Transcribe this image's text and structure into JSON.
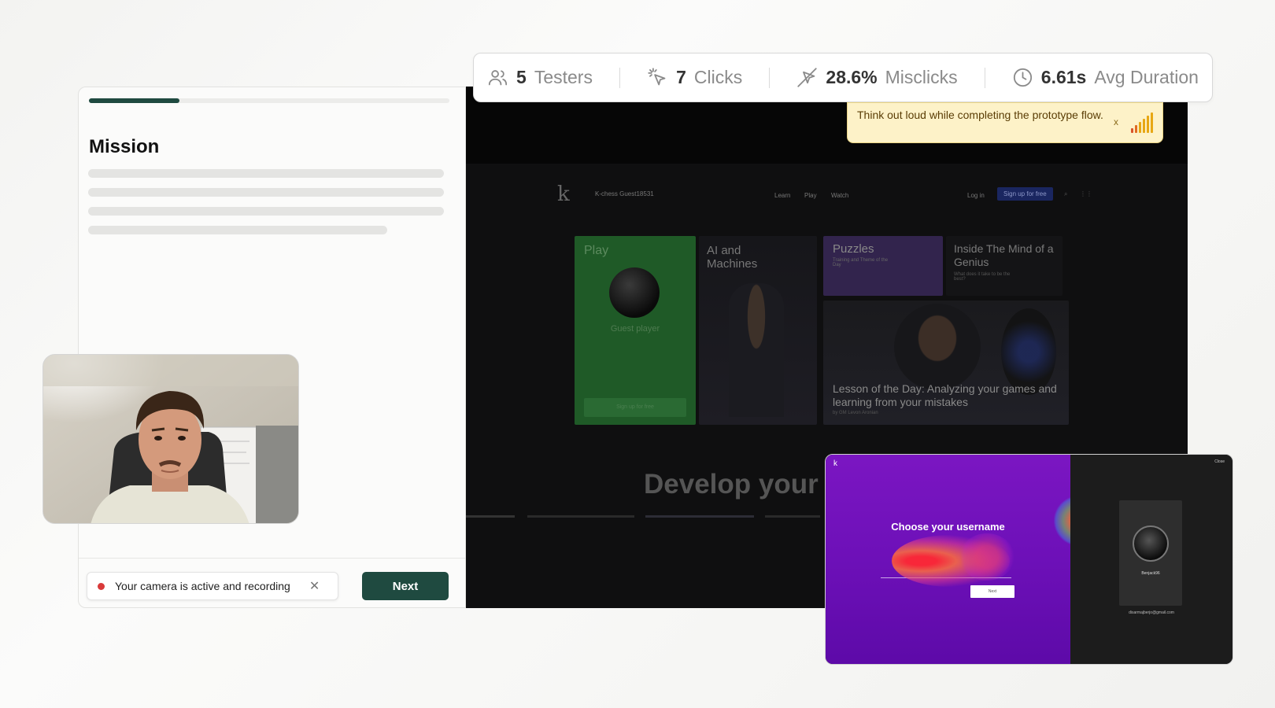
{
  "stats": {
    "testers": {
      "value": "5",
      "label": "Testers",
      "icon": "users-icon"
    },
    "clicks": {
      "value": "7",
      "label": "Clicks",
      "icon": "cursor-click-icon"
    },
    "misclicks": {
      "value": "28.6%",
      "label": "Misclicks",
      "icon": "cursor-off-icon"
    },
    "duration": {
      "value": "6.61s",
      "label": "Avg Duration",
      "icon": "clock-icon"
    }
  },
  "mission": {
    "title": "Mission",
    "progress": 0.25
  },
  "recording": {
    "status_text": "Your camera is active and recording",
    "close_glyph": "✕"
  },
  "next_label": "Next",
  "tooltip": {
    "text": "Think out loud while completing the prototype flow.",
    "close_glyph": "x"
  },
  "prototype": {
    "user": "K-chess Guest18531",
    "nav": [
      "Learn",
      "Play",
      "Watch"
    ],
    "login": "Log in",
    "signup": "Sign up for free",
    "tiles": {
      "play_title": "Play",
      "guest_player": "Guest player",
      "play_cta": "Sign up for free",
      "ai_title": "AI and Machines",
      "puzzles_title": "Puzzles",
      "puzzles_sub": "Training and Theme of the Day",
      "mind_title": "Inside The Mind of a Genius",
      "mind_sub": "What does it take to be the best?",
      "lesson_title": "Lesson of the Day: Analyzing your games and learning from your mistakes",
      "lesson_sub": "by GM Levon Aronian"
    },
    "headline": "Develop your"
  },
  "heatmap": {
    "title": "Choose your username",
    "next_label": "Next",
    "player_name": "Benjack96",
    "email": "disarmajberjo@gmail.com",
    "top_right": "Close"
  },
  "colors": {
    "accent": "#1f4a40",
    "record": "#d93a3a",
    "tooltip_bg": "#fdf2c8",
    "heat_purple": "#6d10b8"
  }
}
